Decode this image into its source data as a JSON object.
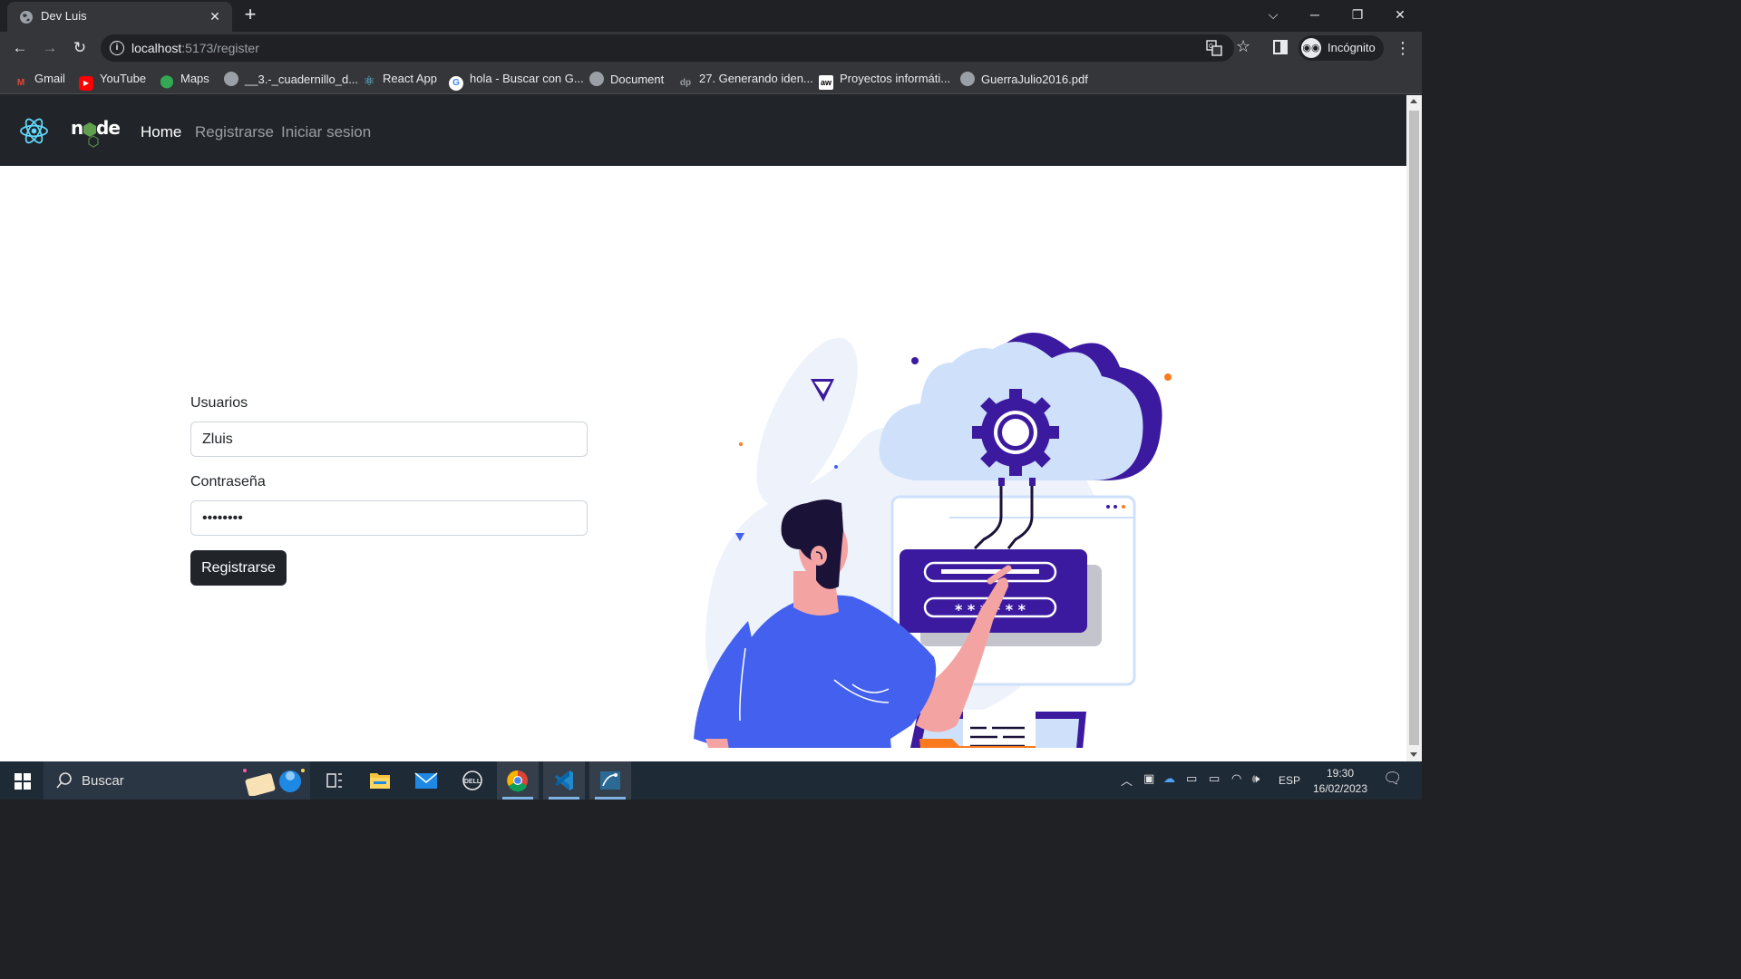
{
  "browser": {
    "tab_title": "Dev Luis",
    "new_tab_symbol": "+",
    "url_host": "localhost",
    "url_path": ":5173/register",
    "profile_label": "Incógnito",
    "window_controls": [
      "minimize-icon",
      "restore-icon",
      "close-icon"
    ]
  },
  "bookmarks": [
    {
      "label": "Gmail",
      "icon": "gmail-icon",
      "color": "#ea4335"
    },
    {
      "label": "YouTube",
      "icon": "youtube-icon",
      "color": "#ff0000"
    },
    {
      "label": "Maps",
      "icon": "maps-icon",
      "color": "#34a853"
    },
    {
      "label": "__3.-_cuadernillo_d...",
      "icon": "globe-icon",
      "color": "#9aa0a6"
    },
    {
      "label": "React App",
      "icon": "react-icon",
      "color": "#61dafb"
    },
    {
      "label": "hola - Buscar con G...",
      "icon": "google-icon",
      "color": "#ffffff"
    },
    {
      "label": "Document",
      "icon": "globe-icon",
      "color": "#9aa0a6"
    },
    {
      "label": "27. Generando iden...",
      "icon": "dp-icon",
      "color": "#202124"
    },
    {
      "label": "Proyectos informáti...",
      "icon": "aw-icon",
      "color": "#ffffff"
    },
    {
      "label": "GuerraJulio2016.pdf",
      "icon": "globe-icon",
      "color": "#9aa0a6"
    }
  ],
  "app": {
    "nav": {
      "home": "Home",
      "register": "Registrarse",
      "login": "Iniciar sesion"
    },
    "form": {
      "user_label": "Usuarios",
      "user_value": "Zluis",
      "password_label": "Contraseña",
      "password_value": "zluis123",
      "submit_label": "Registrarse"
    },
    "colors": {
      "navbar": "#212529",
      "accent_purple": "#3c1aa0",
      "accent_blue": "#4361ee",
      "accent_orange": "#fb7a1e"
    }
  },
  "illustration": {
    "password_mask": "* * * * * *"
  },
  "taskbar": {
    "search_label": "Buscar",
    "language": "ESP",
    "time": "19:30",
    "date": "16/02/2023"
  }
}
